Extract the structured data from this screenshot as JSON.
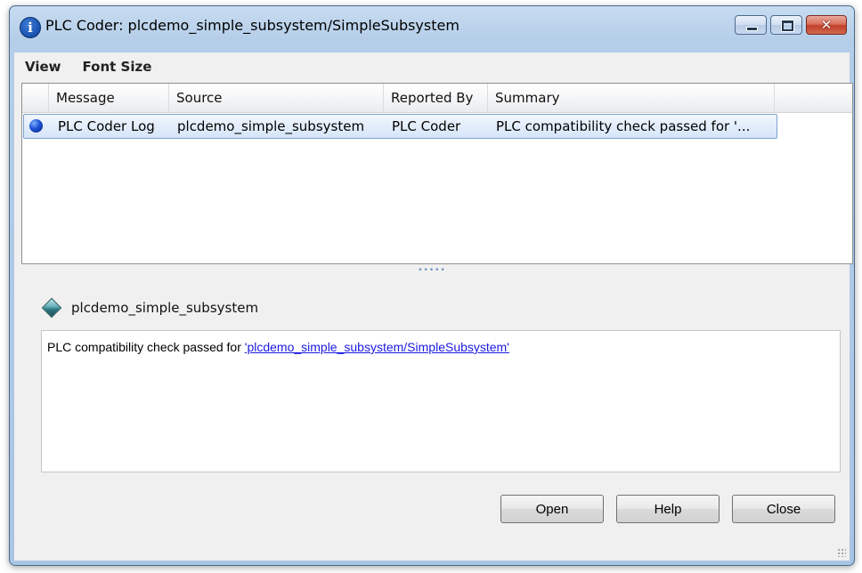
{
  "window": {
    "title": "PLC Coder: plcdemo_simple_subsystem/SimpleSubsystem",
    "close_glyph": "✕"
  },
  "menu": {
    "items": [
      "View",
      "Font Size"
    ]
  },
  "table": {
    "columns": [
      "Message",
      "Source",
      "Reported By",
      "Summary"
    ],
    "rows": [
      {
        "message": "PLC Coder Log",
        "source": "plcdemo_simple_subsystem",
        "reported_by": "PLC Coder",
        "summary": "PLC compatibility check passed for '..."
      }
    ],
    "splitter": "•••••"
  },
  "detail": {
    "model_name": "plcdemo_simple_subsystem",
    "message_prefix": "PLC compatibility check passed for ",
    "link_text": "'plcdemo_simple_subsystem/SimpleSubsystem'"
  },
  "buttons": {
    "open": "Open",
    "help": "Help",
    "close": "Close"
  },
  "colors": {
    "link": "#1a1ae0",
    "selection_border": "#7da2ce",
    "close_button": "#c0402a"
  }
}
